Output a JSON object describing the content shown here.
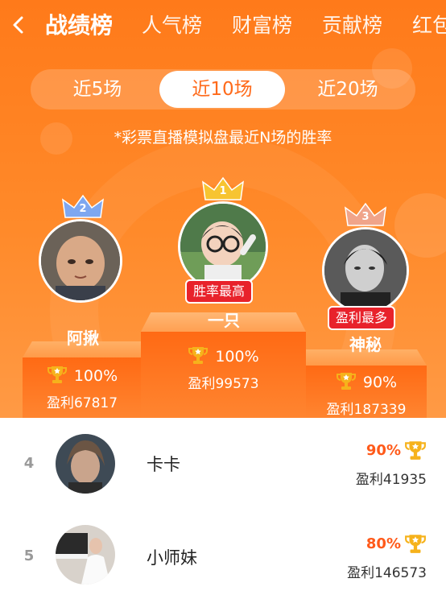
{
  "nav": {
    "back_icon": "chevron-left-icon",
    "tabs": [
      {
        "label": "战绩榜",
        "active": true
      },
      {
        "label": "人气榜",
        "active": false
      },
      {
        "label": "财富榜",
        "active": false
      },
      {
        "label": "贡献榜",
        "active": false
      },
      {
        "label": "红包",
        "active": false
      }
    ]
  },
  "segments": {
    "items": [
      "近5场",
      "近10场",
      "近20场"
    ],
    "selected": "近10场"
  },
  "note": "*彩票直播模拟盘最近N场的胜率",
  "podium": {
    "first": {
      "rank": "1",
      "name": "一只",
      "badge": "胜率最高",
      "rate": "100%",
      "profit": "盈利99573"
    },
    "second": {
      "rank": "2",
      "name": "阿揪",
      "rate": "100%",
      "profit": "盈利67817"
    },
    "third": {
      "rank": "3",
      "name": "神秘",
      "badge": "盈利最多",
      "rate": "90%",
      "profit": "盈利187339"
    }
  },
  "list": [
    {
      "rank": "4",
      "name": "卡卡",
      "rate": "90%",
      "profit": "盈利41935"
    },
    {
      "rank": "5",
      "name": "小师妹",
      "rate": "80%",
      "profit": "盈利146573"
    }
  ],
  "colors": {
    "brand_orange": "#ff7a1a",
    "badge_red": "#e8222b",
    "gold": "#f6b21b",
    "crown_1": "#f7c431",
    "crown_2": "#7ea7f0",
    "crown_3": "#f0a48a"
  }
}
